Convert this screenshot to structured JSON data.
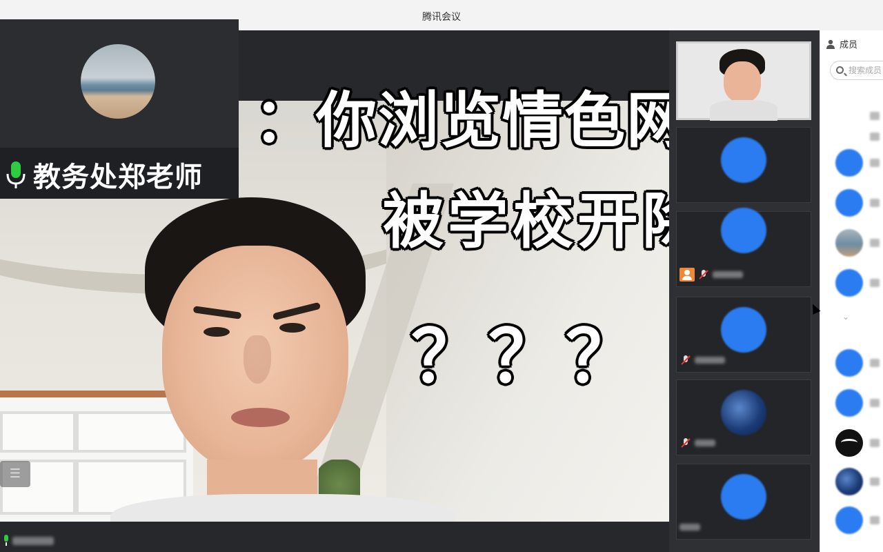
{
  "window": {
    "title": "腾讯会议"
  },
  "speaker": {
    "name": "教务处郑老师"
  },
  "caption": {
    "line1": "：你浏览情色网站",
    "line2": "被学校开除了",
    "line3": "？？？"
  },
  "members_panel": {
    "header": "成员",
    "search_placeholder": "搜索成员"
  },
  "colors": {
    "stage": "#26282b",
    "avatar_blue": "#2a7cf0",
    "accent_orange": "#f0883a"
  },
  "icons": [
    "microphone-icon",
    "list-icon",
    "muted-mic-icon",
    "person-icon",
    "search-icon",
    "member-icon",
    "chevron-down-icon",
    "cursor-icon"
  ]
}
